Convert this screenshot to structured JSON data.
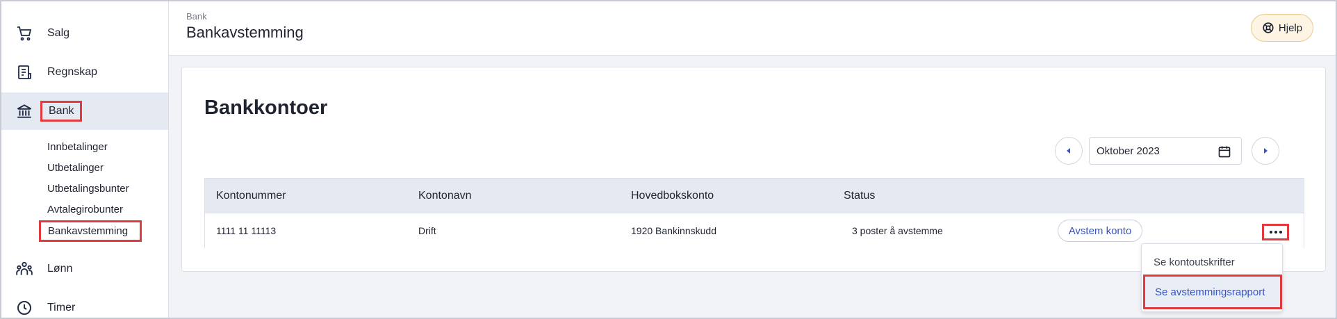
{
  "sidebar": {
    "items": [
      {
        "label": "Salg",
        "icon": "cart-icon"
      },
      {
        "label": "Regnskap",
        "icon": "ledger-icon"
      },
      {
        "label": "Bank",
        "icon": "bank-icon"
      },
      {
        "label": "Lønn",
        "icon": "people-icon"
      },
      {
        "label": "Timer",
        "icon": "clock-icon"
      }
    ],
    "bank_sub": [
      "Innbetalinger",
      "Utbetalinger",
      "Utbetalingsbunter",
      "Avtalegirobunter",
      "Bankavstemming"
    ]
  },
  "header": {
    "breadcrumb": "Bank",
    "title": "Bankavstemming",
    "help_label": "Hjelp"
  },
  "card": {
    "title": "Bankkontoer",
    "period": "Oktober 2023"
  },
  "table": {
    "columns": [
      "Kontonummer",
      "Kontonavn",
      "Hovedbokskonto",
      "Status"
    ],
    "rows": [
      {
        "kontonummer": "1111 11 11113",
        "kontonavn": "Drift",
        "hovedbokskonto": "1920 Bankinnskudd",
        "status": "3 poster å avstemme",
        "action": "Avstem konto"
      }
    ]
  },
  "dropdown": {
    "items": [
      "Se kontoutskrifter",
      "Se avstemmingsrapport"
    ]
  },
  "colors": {
    "accent": "#3554c7",
    "highlight": "#e0393e",
    "active_bg": "#e5e9f2"
  }
}
